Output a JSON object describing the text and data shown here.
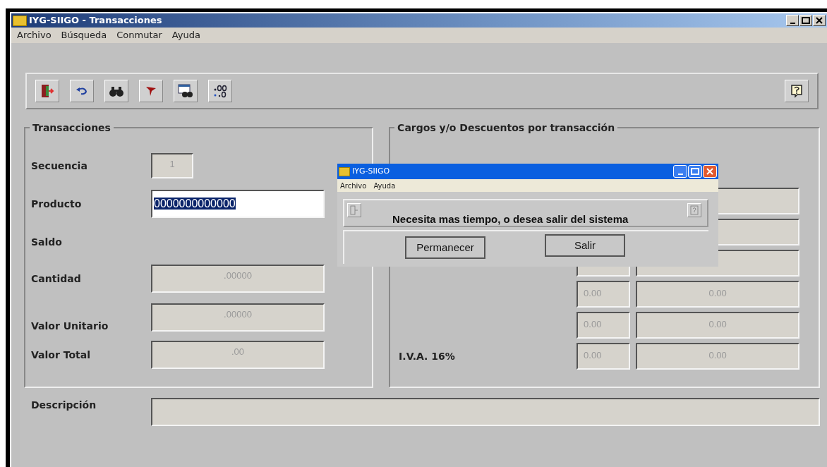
{
  "window": {
    "title": "IYG-SIIGO - Transacciones"
  },
  "menu": [
    "Archivo",
    "Búsqueda",
    "Conmutar",
    "Ayuda"
  ],
  "toolbar": [
    {
      "kind": "exit"
    },
    {
      "kind": "undo"
    },
    {
      "kind": "search"
    },
    {
      "kind": "filter"
    },
    {
      "kind": "find-window"
    },
    {
      "kind": "decimal"
    }
  ],
  "transacciones": {
    "title": "Transacciones",
    "fields": [
      {
        "label": "Secuencia",
        "kind": "short",
        "value": "1",
        "disabled": true
      },
      {
        "label": "Producto",
        "kind": "wide",
        "value": "0000000000000",
        "disabled": false
      },
      {
        "label": "Saldo",
        "kind": "label"
      },
      {
        "label": "Cantidad",
        "kind": "wide",
        "value": ".00000",
        "disabled": true
      },
      {
        "label": "Valor Unitario",
        "kind": "wide",
        "value": ".00000",
        "disabled": true
      },
      {
        "label": "Valor Total",
        "kind": "wide",
        "value": ".00",
        "disabled": true
      }
    ]
  },
  "cargos": {
    "title": "Cargos y/o Descuentos por transacción",
    "rows": [
      {
        "kind": "single",
        "disabled": true
      },
      {
        "kind": "single",
        "disabled": true
      },
      {
        "kind": "pair",
        "disabled": true
      },
      {
        "kind": "pair",
        "disabled": true,
        "value_1": "0.00",
        "value_2": "0.00"
      },
      {
        "kind": "pair",
        "disabled": true,
        "value_1": "0.00",
        "value_2": "0.00"
      },
      {
        "kind": "pair",
        "disabled": true,
        "label": "I.V.A. 16%",
        "value_1": "0.00",
        "value_2": "0.00"
      }
    ]
  },
  "description": {
    "label": "Descripción"
  },
  "dialog": {
    "title": "IYG-SIIGO",
    "menu": [
      "Archivo",
      "Ayuda"
    ],
    "message": "Necesita mas tiempo, o desea salir del sistema",
    "buttons": [
      "Permanecer",
      "Salir"
    ]
  }
}
